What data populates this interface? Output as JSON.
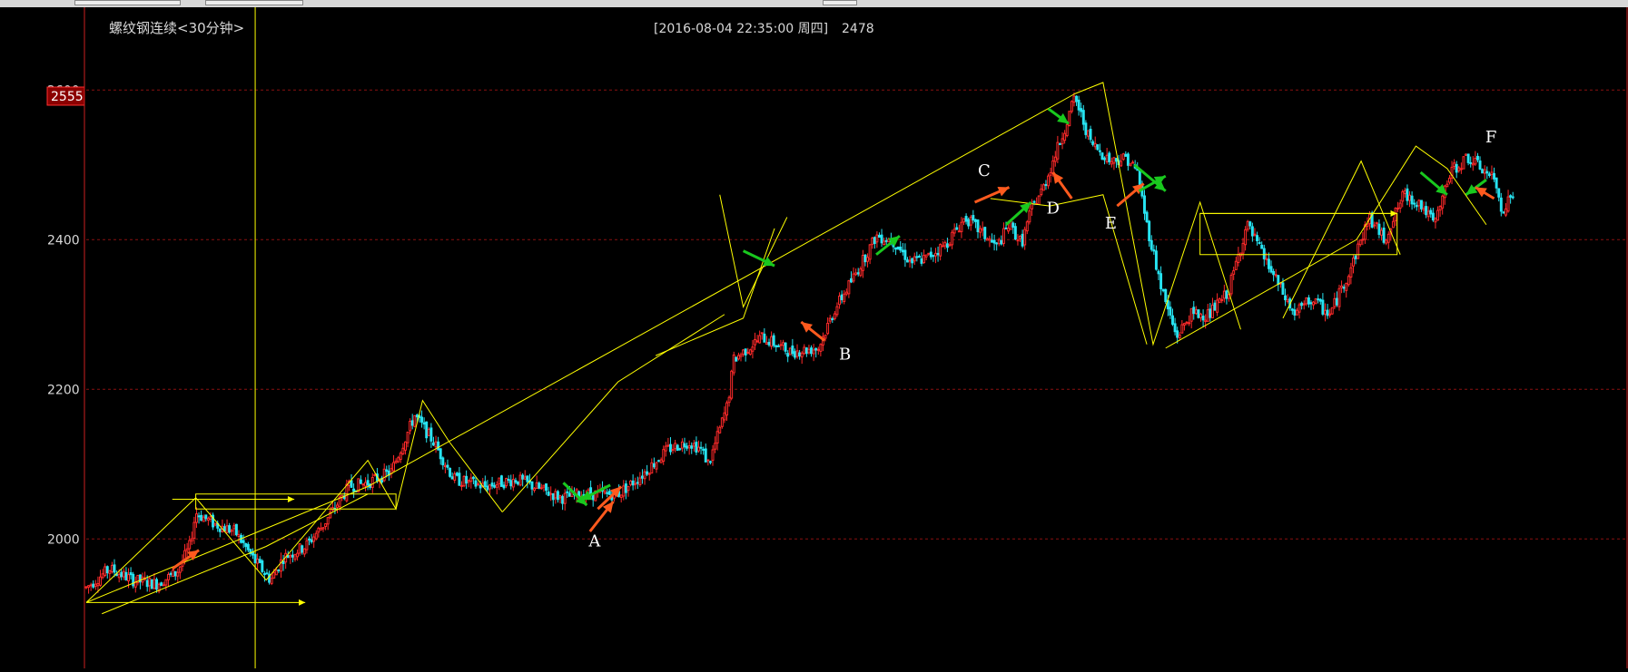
{
  "title": "螺纹钢连续<30分钟>",
  "header_info": "[2016-08-04  22:35:00 周四]",
  "header_value": "2478",
  "price_badge": "2555",
  "colors": {
    "up": "#ff2a2a",
    "down": "#27e4f2",
    "trend": "#ffff00",
    "grid": "#8a1010",
    "red_arrow": "#ff5a1e",
    "green_arrow": "#19c81e"
  },
  "annotations": [
    {
      "label": "A",
      "x": 325,
      "y": 1990
    },
    {
      "label": "B",
      "x": 485,
      "y": 2240
    },
    {
      "label": "C",
      "x": 574,
      "y": 2485
    },
    {
      "label": "D",
      "x": 618,
      "y": 2435
    },
    {
      "label": "E",
      "x": 655,
      "y": 2415
    },
    {
      "label": "F",
      "x": 898,
      "y": 2530
    }
  ],
  "chart_data": {
    "type": "candlestick",
    "ylim": [
      1850,
      2650
    ],
    "xlim": [
      0,
      920
    ],
    "yticks": [
      2000,
      2200,
      2400,
      2600
    ],
    "grid": true,
    "crosshair_x": 108,
    "anchors": [
      [
        0,
        1935
      ],
      [
        15,
        1960
      ],
      [
        30,
        1945
      ],
      [
        45,
        1940
      ],
      [
        58,
        1955
      ],
      [
        66,
        1990
      ],
      [
        70,
        2035
      ],
      [
        82,
        2020
      ],
      [
        95,
        2010
      ],
      [
        108,
        1970
      ],
      [
        118,
        1945
      ],
      [
        126,
        1975
      ],
      [
        140,
        1990
      ],
      [
        152,
        2020
      ],
      [
        168,
        2070
      ],
      [
        180,
        2075
      ],
      [
        195,
        2090
      ],
      [
        210,
        2165
      ],
      [
        222,
        2130
      ],
      [
        235,
        2080
      ],
      [
        255,
        2070
      ],
      [
        275,
        2080
      ],
      [
        292,
        2065
      ],
      [
        304,
        2055
      ],
      [
        318,
        2060
      ],
      [
        340,
        2060
      ],
      [
        355,
        2085
      ],
      [
        372,
        2120
      ],
      [
        385,
        2130
      ],
      [
        393,
        2120
      ],
      [
        398,
        2100
      ],
      [
        410,
        2180
      ],
      [
        414,
        2240
      ],
      [
        432,
        2270
      ],
      [
        450,
        2250
      ],
      [
        468,
        2255
      ],
      [
        478,
        2305
      ],
      [
        492,
        2355
      ],
      [
        505,
        2405
      ],
      [
        515,
        2400
      ],
      [
        527,
        2370
      ],
      [
        537,
        2375
      ],
      [
        550,
        2395
      ],
      [
        562,
        2430
      ],
      [
        572,
        2410
      ],
      [
        582,
        2390
      ],
      [
        590,
        2420
      ],
      [
        598,
        2395
      ],
      [
        604,
        2440
      ],
      [
        612,
        2470
      ],
      [
        624,
        2540
      ],
      [
        632,
        2590
      ],
      [
        642,
        2530
      ],
      [
        655,
        2505
      ],
      [
        665,
        2510
      ],
      [
        672,
        2490
      ],
      [
        678,
        2420
      ],
      [
        688,
        2330
      ],
      [
        697,
        2270
      ],
      [
        706,
        2300
      ],
      [
        718,
        2300
      ],
      [
        730,
        2330
      ],
      [
        742,
        2420
      ],
      [
        752,
        2380
      ],
      [
        762,
        2340
      ],
      [
        772,
        2300
      ],
      [
        783,
        2320
      ],
      [
        795,
        2300
      ],
      [
        808,
        2360
      ],
      [
        820,
        2430
      ],
      [
        830,
        2400
      ],
      [
        842,
        2460
      ],
      [
        852,
        2450
      ],
      [
        862,
        2420
      ],
      [
        872,
        2490
      ],
      [
        883,
        2510
      ],
      [
        892,
        2495
      ],
      [
        900,
        2480
      ],
      [
        905,
        2440
      ],
      [
        912,
        2460
      ]
    ],
    "trend_lines": [
      [
        [
          0,
          1915
        ],
        [
          180,
          2070
        ],
        [
          632,
          2595
        ]
      ],
      [
        [
          10,
          1900
        ],
        [
          115,
          1990
        ],
        [
          180,
          2060
        ]
      ],
      [
        [
          0,
          1915
        ],
        [
          70,
          2055
        ],
        [
          115,
          1945
        ],
        [
          180,
          2105
        ],
        [
          198,
          2040
        ],
        [
          215,
          2185
        ],
        [
          232,
          2130
        ],
        [
          266,
          2036
        ]
      ],
      [
        [
          266,
          2036
        ],
        [
          340,
          2210
        ],
        [
          408,
          2300
        ]
      ],
      [
        [
          364,
          2245
        ],
        [
          420,
          2295
        ],
        [
          440,
          2415
        ]
      ],
      [
        [
          405,
          2460
        ],
        [
          420,
          2310
        ],
        [
          448,
          2430
        ]
      ],
      [
        [
          578,
          2455
        ],
        [
          616,
          2445
        ],
        [
          650,
          2460
        ],
        [
          678,
          2260
        ]
      ],
      [
        [
          632,
          2595
        ],
        [
          650,
          2610
        ],
        [
          682,
          2260
        ],
        [
          712,
          2450
        ],
        [
          738,
          2280
        ]
      ],
      [
        [
          690,
          2255
        ],
        [
          812,
          2400
        ],
        [
          850,
          2525
        ],
        [
          870,
          2495
        ],
        [
          895,
          2420
        ]
      ],
      [
        [
          765,
          2295
        ],
        [
          815,
          2505
        ],
        [
          840,
          2380
        ]
      ]
    ],
    "boxes": [
      [
        [
          70,
          2040
        ],
        [
          198,
          2060
        ]
      ],
      [
        [
          712,
          2380
        ],
        [
          838,
          2435
        ]
      ]
    ],
    "horizontal_arrows": [
      [
        [
          55,
          2053
        ],
        [
          133,
          2053
        ]
      ],
      [
        [
          0,
          1915
        ],
        [
          140,
          1915
        ]
      ],
      [
        [
          712,
          2435
        ],
        [
          838,
          2435
        ]
      ]
    ],
    "arrows": [
      {
        "color": "red",
        "from": [
          55,
          1960
        ],
        "to": [
          72,
          1985
        ]
      },
      {
        "color": "green",
        "from": [
          305,
          2075
        ],
        "to": [
          320,
          2045
        ]
      },
      {
        "color": "red",
        "from": [
          322,
          2010
        ],
        "to": [
          337,
          2050
        ]
      },
      {
        "color": "red",
        "from": [
          327,
          2040
        ],
        "to": [
          342,
          2070
        ]
      },
      {
        "color": "green",
        "from": [
          335,
          2072
        ],
        "to": [
          316,
          2052
        ]
      },
      {
        "color": "green",
        "from": [
          420,
          2385
        ],
        "to": [
          440,
          2365
        ]
      },
      {
        "color": "red",
        "from": [
          472,
          2265
        ],
        "to": [
          457,
          2290
        ]
      },
      {
        "color": "green",
        "from": [
          505,
          2380
        ],
        "to": [
          520,
          2405
        ]
      },
      {
        "color": "red",
        "from": [
          568,
          2450
        ],
        "to": [
          590,
          2470
        ]
      },
      {
        "color": "green",
        "from": [
          588,
          2420
        ],
        "to": [
          604,
          2450
        ]
      },
      {
        "color": "red",
        "from": [
          630,
          2455
        ],
        "to": [
          618,
          2490
        ]
      },
      {
        "color": "green",
        "from": [
          615,
          2575
        ],
        "to": [
          628,
          2555
        ]
      },
      {
        "color": "red",
        "from": [
          659,
          2445
        ],
        "to": [
          676,
          2475
        ]
      },
      {
        "color": "green",
        "from": [
          670,
          2500
        ],
        "to": [
          690,
          2465
        ]
      },
      {
        "color": "green",
        "from": [
          673,
          2465
        ],
        "to": [
          690,
          2485
        ]
      },
      {
        "color": "green",
        "from": [
          853,
          2490
        ],
        "to": [
          870,
          2460
        ]
      },
      {
        "color": "green",
        "from": [
          895,
          2480
        ],
        "to": [
          882,
          2460
        ]
      },
      {
        "color": "red",
        "from": [
          900,
          2455
        ],
        "to": [
          888,
          2470
        ]
      }
    ]
  }
}
